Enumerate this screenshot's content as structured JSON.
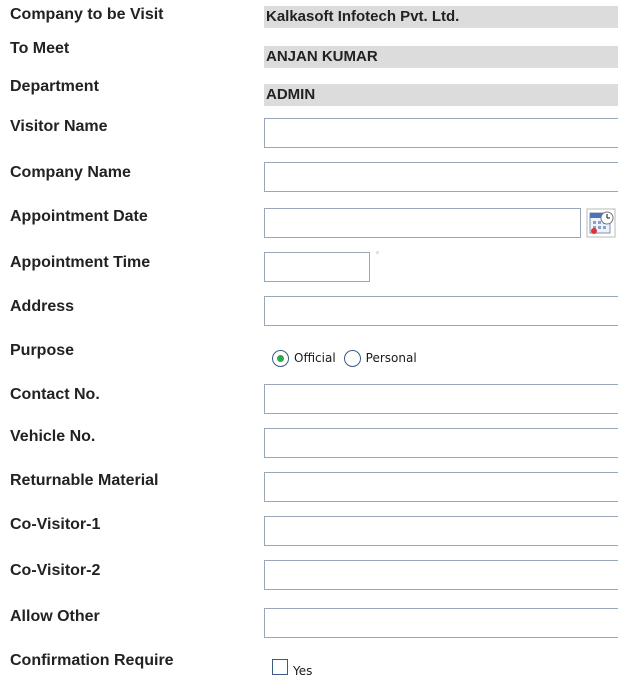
{
  "labels": {
    "company_to_visit": "Company to be Visit",
    "to_meet": "To Meet",
    "department": "Department",
    "visitor_name": "Visitor Name",
    "company_name": "Company Name",
    "appointment_date": "Appointment Date",
    "appointment_time": "Appointment Time",
    "address": "Address",
    "purpose": "Purpose",
    "contact_no": "Contact No.",
    "vehicle_no": "Vehicle No.",
    "returnable_material": "Returnable Material",
    "co_visitor_1": "Co-Visitor-1",
    "co_visitor_2": "Co-Visitor-2",
    "allow_other": "Allow Other",
    "confirmation_require": "Confirmation Require"
  },
  "values": {
    "company_to_visit": "Kalkasoft Infotech Pvt. Ltd.",
    "to_meet": "ANJAN KUMAR",
    "department": "ADMIN",
    "visitor_name": "",
    "company_name": "",
    "appointment_date": "",
    "appointment_time": "",
    "address": "",
    "contact_no": "",
    "vehicle_no": "",
    "returnable_material": "",
    "co_visitor_1": "",
    "co_visitor_2": "",
    "allow_other": ""
  },
  "purpose": {
    "options": [
      "Official",
      "Personal"
    ],
    "selected": "Official"
  },
  "confirmation": {
    "option_label": "Yes",
    "checked": false
  },
  "icons": {
    "calendar": "calendar-icon"
  }
}
